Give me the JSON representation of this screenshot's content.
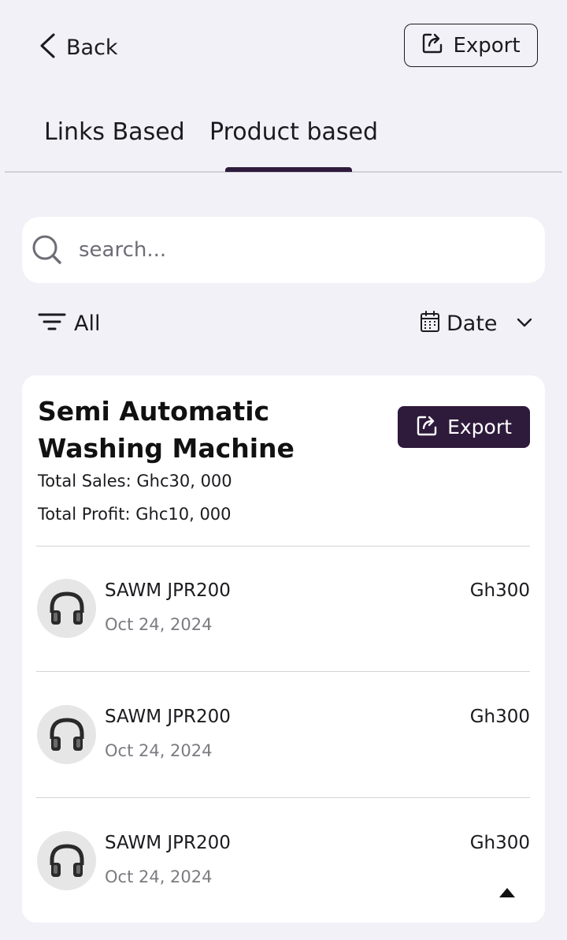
{
  "header": {
    "back_label": "Back",
    "export_label": "Export"
  },
  "tabs": [
    {
      "label": "Links Based",
      "active": false
    },
    {
      "label": "Product based",
      "active": true
    }
  ],
  "search": {
    "placeholder": "search...",
    "value": ""
  },
  "filters": {
    "category_label": "All",
    "sort_label": "Date"
  },
  "product": {
    "title": "Semi Automatic Washing Machine",
    "export_label": "Export",
    "total_sales": "Total Sales: Ghc30, 000",
    "total_profit": "Total Profit: Ghc10, 000",
    "items": [
      {
        "name": "SAWM JPR200",
        "date": "Oct 24, 2024",
        "price": "Gh300",
        "icon": "headphones-icon"
      },
      {
        "name": "SAWM JPR200",
        "date": "Oct 24, 2024",
        "price": "Gh300",
        "icon": "headphones-icon"
      },
      {
        "name": "SAWM JPR200",
        "date": "Oct 24, 2024",
        "price": "Gh300",
        "icon": "headphones-icon"
      }
    ]
  },
  "colors": {
    "accent": "#2e1a3b",
    "background": "#f1f1f7",
    "card": "#ffffff"
  }
}
